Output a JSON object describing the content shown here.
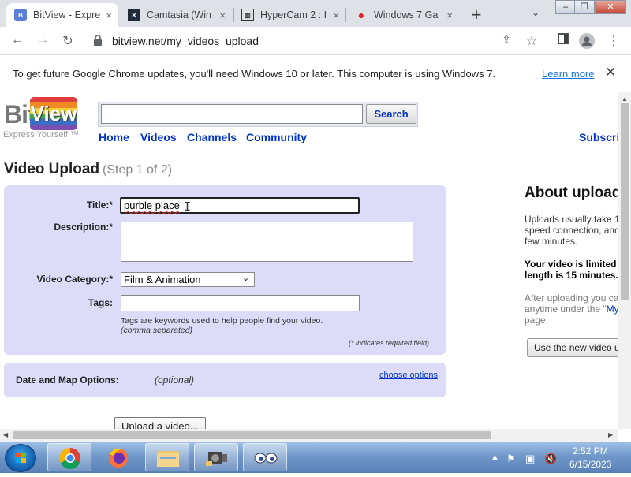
{
  "browser": {
    "tabs": [
      {
        "label": "BitView - Expre",
        "active": true
      },
      {
        "label": "Camtasia (Win",
        "active": false
      },
      {
        "label": "HyperCam 2 : I",
        "active": false
      },
      {
        "label": "Windows 7 Ga",
        "active": false
      }
    ],
    "close_glyph": "×",
    "new_tab_glyph": "+",
    "url": "bitview.net/my_videos_upload",
    "info_bar": {
      "text": "To get future Google Chrome updates, you'll need Windows 10 or later. This computer is using Windows 7.",
      "link": "Learn more",
      "close_glyph": "✕"
    }
  },
  "site": {
    "logo_bit": "Bit",
    "logo_view": "View",
    "tagline": "Express Yourself ™",
    "search_button": "Search",
    "nav": [
      "Home",
      "Videos",
      "Channels",
      "Community"
    ],
    "nav_right": "Subscrip"
  },
  "upload": {
    "heading": "Video Upload",
    "step": "(Step 1 of 2)",
    "title_label": "Title:*",
    "title_value": "purble place",
    "description_label": "Description:*",
    "category_label": "Video Category:*",
    "category_value": "Film & Animation",
    "tags_label": "Tags:",
    "tags_help": "Tags are keywords used to help people find your video.",
    "tags_help_note": "(comma separated)",
    "required_note": "(* indicates required field)",
    "date_label": "Date and Map Options:",
    "date_optional": "(optional)",
    "choose_options": "choose options",
    "upload_button": "Upload a video..."
  },
  "sidebar": {
    "heading": "About upload",
    "para1": [
      "Uploads usually take 1",
      "speed connection, and",
      "few minutes."
    ],
    "para2": [
      "Your video is limited",
      "length is 15 minutes."
    ],
    "para3_line1": "After uploading you ca",
    "para3_line2_pre": "anytime under the \"",
    "para3_line2_link": "My",
    "para3_line3": "page.",
    "button": "Use the new video u"
  },
  "taskbar": {
    "time": "2:52 PM",
    "date": "6/15/2023"
  },
  "colors": {
    "accent_link": "#0033cc",
    "panel": "#dcdcf8",
    "chrome_link": "#1a73e8"
  }
}
